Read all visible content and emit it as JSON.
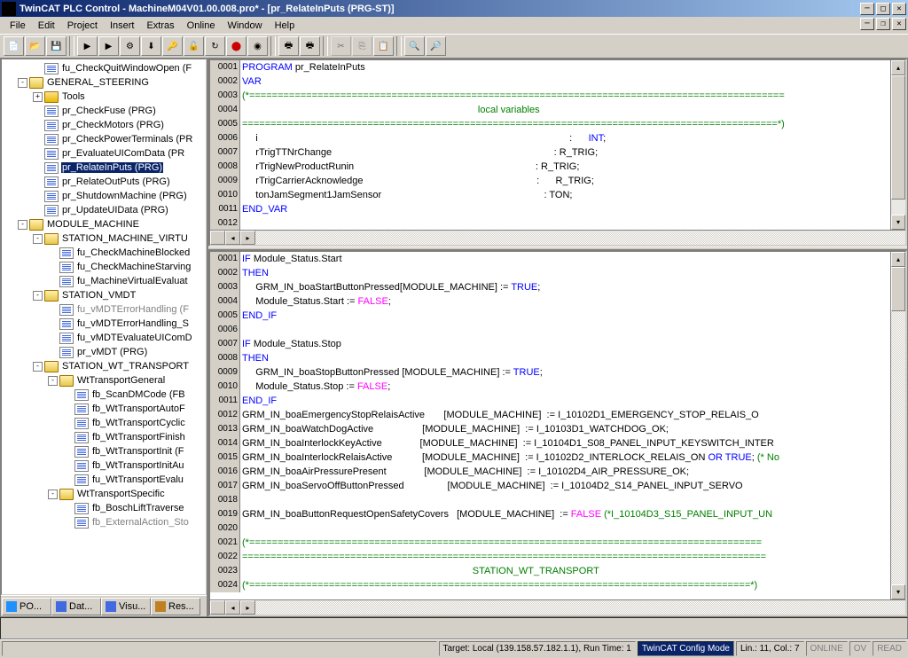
{
  "title": "TwinCAT PLC Control - MachineM04V01.00.008.pro* - [pr_RelateInPuts (PRG-ST)]",
  "menu": [
    "File",
    "Edit",
    "Project",
    "Insert",
    "Extras",
    "Online",
    "Window",
    "Help"
  ],
  "tree": [
    {
      "d": 1,
      "e": "",
      "t": "file",
      "lbl": "fu_CheckQuitWindowOpen (F"
    },
    {
      "d": 0,
      "e": "-",
      "t": "folderopen",
      "lbl": "GENERAL_STEERING"
    },
    {
      "d": 1,
      "e": "+",
      "t": "folder",
      "lbl": "Tools"
    },
    {
      "d": 1,
      "e": "",
      "t": "file",
      "lbl": "pr_CheckFuse (PRG)"
    },
    {
      "d": 1,
      "e": "",
      "t": "file",
      "lbl": "pr_CheckMotors (PRG)"
    },
    {
      "d": 1,
      "e": "",
      "t": "file",
      "lbl": "pr_CheckPowerTerminals (PR"
    },
    {
      "d": 1,
      "e": "",
      "t": "file",
      "lbl": "pr_EvaluateUIComData (PR"
    },
    {
      "d": 1,
      "e": "",
      "t": "file",
      "lbl": "pr_RelateInPuts (PRG)",
      "sel": true
    },
    {
      "d": 1,
      "e": "",
      "t": "file",
      "lbl": "pr_RelateOutPuts (PRG)"
    },
    {
      "d": 1,
      "e": "",
      "t": "file",
      "lbl": "pr_ShutdownMachine (PRG)"
    },
    {
      "d": 1,
      "e": "",
      "t": "file",
      "lbl": "pr_UpdateUIData (PRG)"
    },
    {
      "d": 0,
      "e": "-",
      "t": "folderopen",
      "lbl": "MODULE_MACHINE"
    },
    {
      "d": 1,
      "e": "-",
      "t": "folderopen",
      "lbl": "STATION_MACHINE_VIRTU"
    },
    {
      "d": 2,
      "e": "",
      "t": "file",
      "lbl": "fu_CheckMachineBlocked"
    },
    {
      "d": 2,
      "e": "",
      "t": "file",
      "lbl": "fu_CheckMachineStarving"
    },
    {
      "d": 2,
      "e": "",
      "t": "file",
      "lbl": "fu_MachineVirtualEvaluat"
    },
    {
      "d": 1,
      "e": "-",
      "t": "folderopen",
      "lbl": "STATION_VMDT"
    },
    {
      "d": 2,
      "e": "",
      "t": "file",
      "lbl": "fu_vMDTErrorHandling (F",
      "gray": true
    },
    {
      "d": 2,
      "e": "",
      "t": "file",
      "lbl": "fu_vMDTErrorHandling_S"
    },
    {
      "d": 2,
      "e": "",
      "t": "file",
      "lbl": "fu_vMDTEvaluateUIComD"
    },
    {
      "d": 2,
      "e": "",
      "t": "file",
      "lbl": "pr_vMDT (PRG)"
    },
    {
      "d": 1,
      "e": "-",
      "t": "folderopen",
      "lbl": "STATION_WT_TRANSPORT"
    },
    {
      "d": 2,
      "e": "-",
      "t": "folderopen",
      "lbl": "WtTransportGeneral"
    },
    {
      "d": 3,
      "e": "",
      "t": "file",
      "lbl": "fb_ScanDMCode (FB"
    },
    {
      "d": 3,
      "e": "",
      "t": "file",
      "lbl": "fb_WtTransportAutoF"
    },
    {
      "d": 3,
      "e": "",
      "t": "file",
      "lbl": "fb_WtTransportCyclic"
    },
    {
      "d": 3,
      "e": "",
      "t": "file",
      "lbl": "fb_WtTransportFinish"
    },
    {
      "d": 3,
      "e": "",
      "t": "file",
      "lbl": "fb_WtTransportInit (F"
    },
    {
      "d": 3,
      "e": "",
      "t": "file",
      "lbl": "fb_WtTransportInitAu"
    },
    {
      "d": 3,
      "e": "",
      "t": "file",
      "lbl": "fu_WtTransportEvalu"
    },
    {
      "d": 2,
      "e": "-",
      "t": "folderopen",
      "lbl": "WtTransportSpecific"
    },
    {
      "d": 3,
      "e": "",
      "t": "file",
      "lbl": "fb_BoschLiftTraverse"
    },
    {
      "d": 3,
      "e": "",
      "t": "file",
      "lbl": "fb_ExternalAction_Sto",
      "gray": true
    }
  ],
  "bottom_tabs": [
    {
      "ico": "#1e90ff",
      "lbl": "PO..."
    },
    {
      "ico": "#4169e1",
      "lbl": "Dat..."
    },
    {
      "ico": "#4169e1",
      "lbl": "Visu..."
    },
    {
      "ico": "#c08020",
      "lbl": "Res..."
    }
  ],
  "decl_lines": [
    {
      "n": "0001",
      "seg": [
        [
          "kw-blue",
          "PROGRAM"
        ],
        [
          "kw-black",
          " pr_RelateInPuts"
        ]
      ]
    },
    {
      "n": "0002",
      "seg": [
        [
          "kw-blue",
          "VAR"
        ]
      ]
    },
    {
      "n": "0003",
      "seg": [
        [
          "kw-green",
          "(*=============================================================================================="
        ]
      ]
    },
    {
      "n": "0004",
      "seg": [
        [
          "kw-green",
          "                                                                                       local variables"
        ]
      ]
    },
    {
      "n": "0005",
      "seg": [
        [
          "kw-green",
          "==============================================================================================*)"
        ]
      ]
    },
    {
      "n": "0006",
      "seg": [
        [
          "kw-black",
          "     i                                                                                                                   :      "
        ],
        [
          "kw-blue",
          "INT"
        ],
        [
          "kw-black",
          ";"
        ]
      ]
    },
    {
      "n": "0007",
      "seg": [
        [
          "kw-black",
          "     rTrigTTNrChange                                                                                  : R_TRIG;"
        ]
      ]
    },
    {
      "n": "0008",
      "seg": [
        [
          "kw-black",
          "     rTrigNewProductRunin                                                                   : R_TRIG;"
        ]
      ]
    },
    {
      "n": "0009",
      "seg": [
        [
          "kw-black",
          "     rTrigCarrierAcknowledge                                                                :      R_TRIG;"
        ]
      ]
    },
    {
      "n": "0010",
      "seg": [
        [
          "kw-black",
          "     tonJamSegment1JamSensor                                                            : TON;"
        ]
      ]
    },
    {
      "n": "0011",
      "seg": [
        [
          "kw-blue",
          "END_VAR"
        ]
      ]
    },
    {
      "n": "0012",
      "seg": [
        [
          "kw-black",
          ""
        ]
      ]
    }
  ],
  "body_lines": [
    {
      "n": "0001",
      "seg": [
        [
          "kw-blue",
          "IF"
        ],
        [
          "kw-black",
          " Module_Status.Start"
        ]
      ]
    },
    {
      "n": "0002",
      "seg": [
        [
          "kw-blue",
          "THEN"
        ]
      ]
    },
    {
      "n": "0003",
      "seg": [
        [
          "kw-black",
          "     GRM_IN_boaStartButtonPressed[MODULE_MACHINE] := "
        ],
        [
          "kw-blue",
          "TRUE"
        ],
        [
          "kw-black",
          ";"
        ]
      ]
    },
    {
      "n": "0004",
      "seg": [
        [
          "kw-black",
          "     Module_Status.Start := "
        ],
        [
          "kw-mag",
          "FALSE"
        ],
        [
          "kw-black",
          ";"
        ]
      ]
    },
    {
      "n": "0005",
      "seg": [
        [
          "kw-blue",
          "END_IF"
        ]
      ]
    },
    {
      "n": "0006",
      "seg": [
        [
          "kw-black",
          ""
        ]
      ]
    },
    {
      "n": "0007",
      "seg": [
        [
          "kw-blue",
          "IF"
        ],
        [
          "kw-black",
          " Module_Status.Stop"
        ]
      ]
    },
    {
      "n": "0008",
      "seg": [
        [
          "kw-blue",
          "THEN"
        ]
      ]
    },
    {
      "n": "0009",
      "seg": [
        [
          "kw-black",
          "     GRM_IN_boaStopButtonPressed [MODULE_MACHINE] := "
        ],
        [
          "kw-blue",
          "TRUE"
        ],
        [
          "kw-black",
          ";"
        ]
      ]
    },
    {
      "n": "0010",
      "seg": [
        [
          "kw-black",
          "     Module_Status.Stop := "
        ],
        [
          "kw-mag",
          "FALSE"
        ],
        [
          "kw-black",
          ";"
        ]
      ]
    },
    {
      "n": "0011",
      "seg": [
        [
          "kw-blue",
          "END_IF"
        ]
      ]
    },
    {
      "n": "0012",
      "seg": [
        [
          "kw-black",
          "GRM_IN_boaEmergencyStopRelaisActive       [MODULE_MACHINE]  := I_10102D1_EMERGENCY_STOP_RELAIS_O"
        ]
      ]
    },
    {
      "n": "0013",
      "seg": [
        [
          "kw-black",
          "GRM_IN_boaWatchDogActive                  [MODULE_MACHINE]  := I_10103D1_WATCHDOG_OK;"
        ]
      ]
    },
    {
      "n": "0014",
      "seg": [
        [
          "kw-black",
          "GRM_IN_boaInterlockKeyActive              [MODULE_MACHINE]  := I_10104D1_S08_PANEL_INPUT_KEYSWITCH_INTER"
        ]
      ]
    },
    {
      "n": "0015",
      "seg": [
        [
          "kw-black",
          "GRM_IN_boaInterlockRelaisActive           [MODULE_MACHINE]  := I_10102D2_INTERLOCK_RELAIS_ON "
        ],
        [
          "kw-blue",
          "OR TRUE"
        ],
        [
          "kw-black",
          "; "
        ],
        [
          "kw-green",
          "(* No"
        ]
      ]
    },
    {
      "n": "0016",
      "seg": [
        [
          "kw-black",
          "GRM_IN_boaAirPressurePresent              [MODULE_MACHINE]  := I_10102D4_AIR_PRESSURE_OK;"
        ]
      ]
    },
    {
      "n": "0017",
      "seg": [
        [
          "kw-black",
          "GRM_IN_boaServoOffButtonPressed                [MODULE_MACHINE]  := I_10104D2_S14_PANEL_INPUT_SERVO"
        ]
      ]
    },
    {
      "n": "0018",
      "seg": [
        [
          "kw-black",
          ""
        ]
      ]
    },
    {
      "n": "0019",
      "seg": [
        [
          "kw-black",
          "GRM_IN_boaButtonRequestOpenSafetyCovers   [MODULE_MACHINE]  := "
        ],
        [
          "kw-mag",
          "FALSE "
        ],
        [
          "kw-green",
          "(*I_10104D3_S15_PANEL_INPUT_UN"
        ]
      ]
    },
    {
      "n": "0020",
      "seg": [
        [
          "kw-black",
          ""
        ]
      ]
    },
    {
      "n": "0021",
      "seg": [
        [
          "kw-green",
          "(*=========================================================================================="
        ]
      ]
    },
    {
      "n": "0022",
      "seg": [
        [
          "kw-green",
          "============================================================================================"
        ]
      ]
    },
    {
      "n": "0023",
      "seg": [
        [
          "kw-green",
          "                                                                                     STATION_WT_TRANSPORT"
        ]
      ]
    },
    {
      "n": "0024",
      "seg": [
        [
          "kw-green",
          "(*========================================================================================*)"
        ]
      ]
    }
  ],
  "status": {
    "target": "Target: Local (139.158.57.182.1.1), Run Time: 1",
    "mode": "TwinCAT Config Mode",
    "pos": "Lin.: 11, Col.: 7",
    "s1": "ONLINE",
    "s2": "OV",
    "s3": "READ"
  }
}
